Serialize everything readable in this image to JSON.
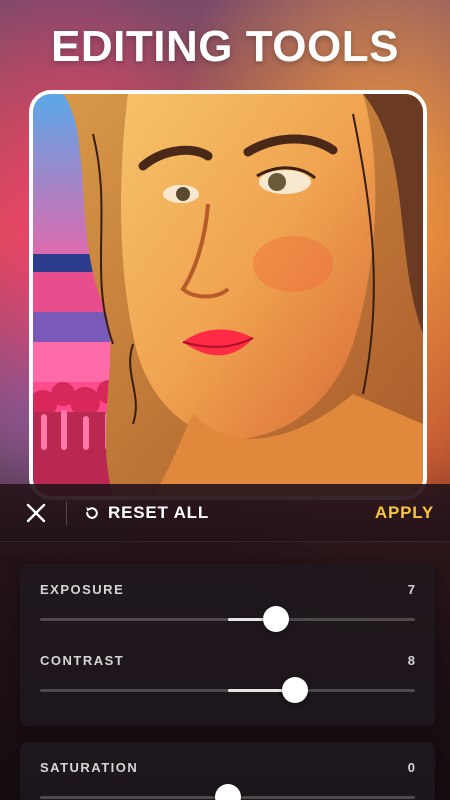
{
  "header": {
    "title": "EDITING TOOLS"
  },
  "toolbar": {
    "close_icon": "close-icon",
    "reset_icon": "reset-icon",
    "reset_label": "RESET ALL",
    "apply_label": "APPLY",
    "accent_color": "#f5c542"
  },
  "adjustments": [
    {
      "label": "EXPOSURE",
      "value": "7",
      "level": 0.63
    },
    {
      "label": "CONTRAST",
      "value": "8",
      "level": 0.68
    },
    {
      "label": "SATURATION",
      "value": "0",
      "level": 0.5
    }
  ]
}
